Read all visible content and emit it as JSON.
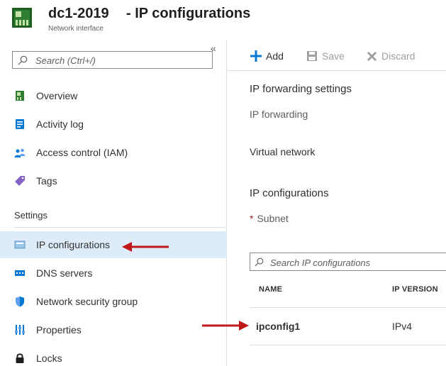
{
  "header": {
    "resource_name": "dc1-2019",
    "separator_title": "- IP configurations",
    "resource_type": "Network interface"
  },
  "sidebar": {
    "collapse_glyph": "«",
    "search": {
      "placeholder": "Search (Ctrl+/)"
    },
    "items": [
      {
        "label": "Overview",
        "icon": "network-interface-icon"
      },
      {
        "label": "Activity log",
        "icon": "activity-log-icon"
      },
      {
        "label": "Access control (IAM)",
        "icon": "people-icon"
      },
      {
        "label": "Tags",
        "icon": "tag-icon"
      }
    ],
    "settings_title": "Settings",
    "settings_items": [
      {
        "label": "IP configurations",
        "icon": "ip-config-icon",
        "active": true
      },
      {
        "label": "DNS servers",
        "icon": "dns-icon"
      },
      {
        "label": "Network security group",
        "icon": "shield-icon"
      },
      {
        "label": "Properties",
        "icon": "properties-icon"
      },
      {
        "label": "Locks",
        "icon": "lock-icon"
      }
    ]
  },
  "toolbar": {
    "add_label": "Add",
    "save_label": "Save",
    "discard_label": "Discard"
  },
  "main": {
    "ip_forwarding_settings_title": "IP forwarding settings",
    "ip_forwarding_label": "IP forwarding",
    "virtual_network_label": "Virtual network",
    "ip_configurations_title": "IP configurations",
    "subnet_required_marker": "*",
    "subnet_label": "Subnet",
    "table_search": {
      "placeholder": "Search IP configurations"
    },
    "table": {
      "columns": [
        "NAME",
        "IP VERSION"
      ],
      "rows": [
        {
          "name": "ipconfig1",
          "ip_version": "IPv4"
        }
      ]
    }
  },
  "colors": {
    "accent": "#0078d4",
    "active_bg": "#deecf9",
    "arrow": "#c0171b",
    "required": "#a4262c"
  }
}
